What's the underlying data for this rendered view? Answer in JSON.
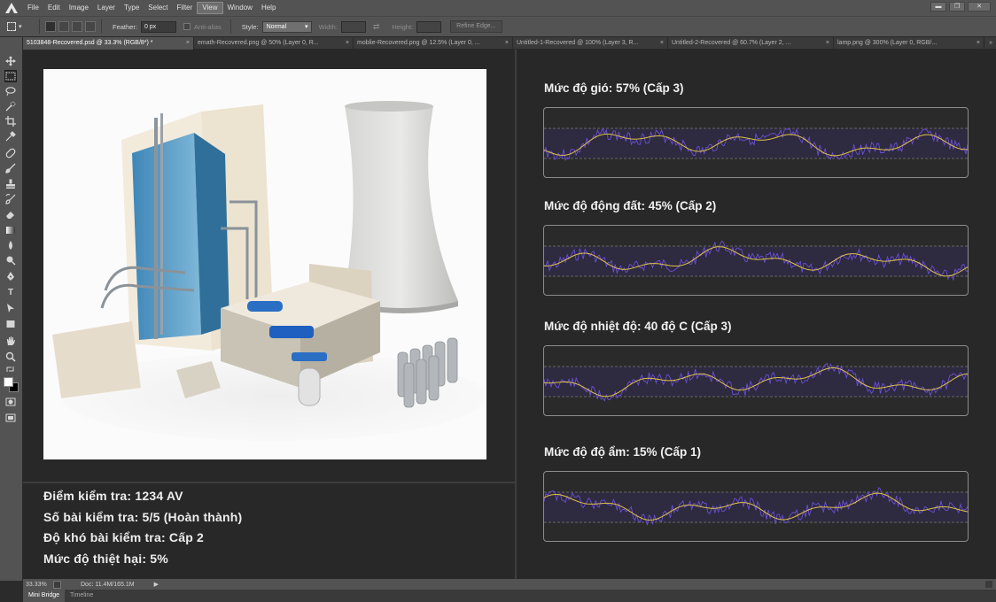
{
  "menu": {
    "items": [
      "File",
      "Edit",
      "Image",
      "Layer",
      "Type",
      "Select",
      "Filter",
      "View",
      "Window",
      "Help"
    ],
    "active": "View"
  },
  "window_controls": {
    "minimize": "▬",
    "restore": "❐",
    "close": "✕"
  },
  "options": {
    "feather_label": "Feather:",
    "feather_value": "0 px",
    "antialias_label": "Anti-alias",
    "style_label": "Style:",
    "style_value": "Normal",
    "width_label": "Width:",
    "height_label": "Height:",
    "swap_glyph": "⇄",
    "refine_edge": "Refine Edge..."
  },
  "tabs": [
    {
      "label": "5103848-Recovered.psd @ 33.3% (RGB/8*) *",
      "active": true
    },
    {
      "label": "emath-Recovered.png @ 50% (Layer 0, R...",
      "active": false
    },
    {
      "label": "moblie-Recovered.png @ 12.5% (Layer 0, ...",
      "active": false
    },
    {
      "label": "Untitled-1-Recovered @ 100% (Layer 3, R...",
      "active": false
    },
    {
      "label": "Untitled-2-Recovered @ 60.7% (Layer 2, ...",
      "active": false
    },
    {
      "label": "lamp.png @ 300% (Layer 0, RGB/...",
      "active": false
    }
  ],
  "tab_close": "×",
  "tabs_more": "»",
  "stats": [
    "Điểm kiểm tra: 1234 AV",
    "Số bài kiểm tra: 5/5 (Hoàn thành)",
    "Độ khó bài kiểm tra: Cấp 2",
    "Mức độ thiệt hại: 5%"
  ],
  "graphs": [
    {
      "title": "Mức độ gió: 57% (Cấp 3)",
      "seed": 3
    },
    {
      "title": "Mức độ động đất: 45% (Cấp 2)",
      "seed": 7
    },
    {
      "title": "Mức độ nhiệt độ: 40 độ C (Cấp 3)",
      "seed": 11
    },
    {
      "title": "Mức độ độ ẩm: 15% (Cấp 1)",
      "seed": 19
    }
  ],
  "colors": {
    "graph_band": "#2e2a3f",
    "graph_noise": "#6b4fd8",
    "graph_smooth": "#e0c24a",
    "graph_dash": "#7a7a7a"
  },
  "status": {
    "zoom": "33.33%",
    "doc": "Doc: 11.4M/165.1M",
    "arrow": "▶"
  },
  "bottom_tabs": [
    {
      "label": "Mini Bridge",
      "active": true
    },
    {
      "label": "Timeline",
      "active": false
    }
  ]
}
